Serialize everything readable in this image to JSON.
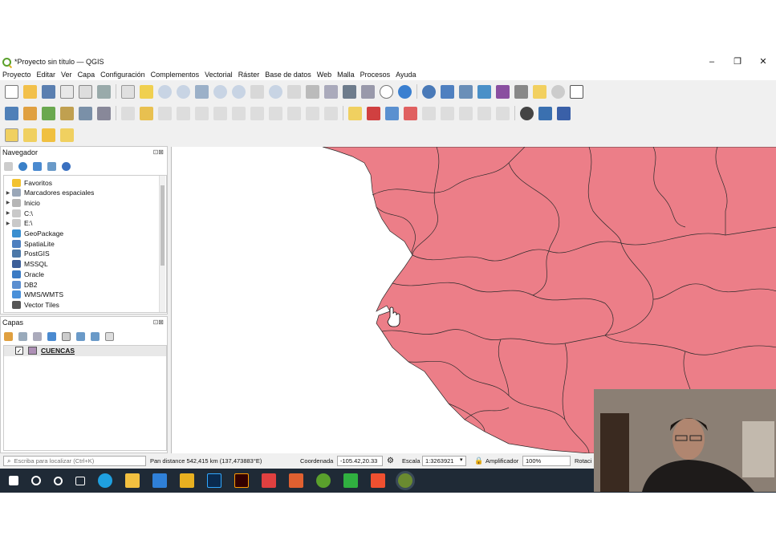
{
  "window": {
    "title": "*Proyecto sin título — QGIS",
    "minimize_glyph": "–",
    "maximize_glyph": "❐",
    "close_glyph": "✕"
  },
  "menu": [
    "Proyecto",
    "Editar",
    "Ver",
    "Capa",
    "Configuración",
    "Complementos",
    "Vectorial",
    "Ráster",
    "Base de datos",
    "Web",
    "Malla",
    "Procesos",
    "Ayuda"
  ],
  "navigator": {
    "title": "Navegador",
    "items": [
      {
        "label": "Favoritos",
        "icon": "star-icon",
        "color": "#f2c230",
        "expandable": false
      },
      {
        "label": "Marcadores espaciales",
        "icon": "bookmark-icon",
        "color": "#9aa7b8",
        "expandable": true
      },
      {
        "label": "Inicio",
        "icon": "home-folder-icon",
        "color": "#b6b6b6",
        "expandable": true
      },
      {
        "label": "C:\\",
        "icon": "drive-icon",
        "color": "#c9c9c9",
        "expandable": true
      },
      {
        "label": "E:\\",
        "icon": "drive-icon",
        "color": "#c9c9c9",
        "expandable": true
      },
      {
        "label": "GeoPackage",
        "icon": "geopackage-icon",
        "color": "#3a8fd0",
        "expandable": false
      },
      {
        "label": "SpatiaLite",
        "icon": "spatialite-icon",
        "color": "#4d7fbf",
        "expandable": false
      },
      {
        "label": "PostGIS",
        "icon": "postgis-icon",
        "color": "#4c78a8",
        "expandable": false
      },
      {
        "label": "MSSQL",
        "icon": "mssql-icon",
        "color": "#3d5f99",
        "expandable": false
      },
      {
        "label": "Oracle",
        "icon": "oracle-icon",
        "color": "#3b7bc4",
        "expandable": false
      },
      {
        "label": "DB2",
        "icon": "db2-icon",
        "color": "#5a8ed0",
        "expandable": false
      },
      {
        "label": "WMS/WMTS",
        "icon": "globe-icon",
        "color": "#4a90d9",
        "expandable": false
      },
      {
        "label": "Vector Tiles",
        "icon": "grid-icon",
        "color": "#555555",
        "expandable": false
      }
    ]
  },
  "layers": {
    "title": "Capas",
    "items": [
      {
        "label": "CUENCAS",
        "checked": true,
        "swatch": "#ad8fb5"
      }
    ]
  },
  "map": {
    "fill_color": "#ec7e88",
    "stroke_color": "#2a2a2a"
  },
  "status": {
    "locator_placeholder": "Escriba para localizar (Ctrl+K)",
    "message": "Pan distance 542,415 km (137,473883°E)",
    "coord_label": "Coordenada",
    "coord_value": "-105.42,20.33",
    "scale_label": "Escala",
    "scale_value": "1:3263921",
    "magnifier_label": "Amplificador",
    "magnifier_value": "100%",
    "rotation_label": "Rotaci"
  },
  "colors": {
    "qgis_green": "#5aa02c",
    "taskbar": "#1f2a36"
  }
}
